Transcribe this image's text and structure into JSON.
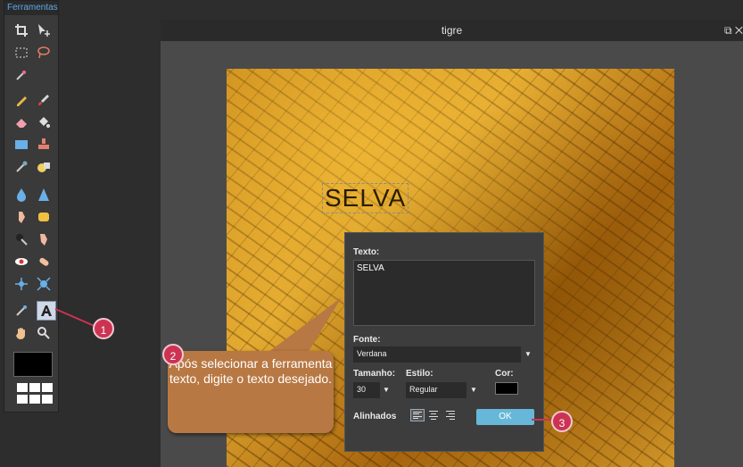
{
  "tools_panel": {
    "title": "Ferramentas"
  },
  "document": {
    "title": "tigre",
    "canvas_text": "SELVA",
    "window_controls": "⧉ ✕"
  },
  "dialog": {
    "text_label": "Texto:",
    "text_value": "SELVA",
    "font_label": "Fonte:",
    "font_value": "Verdana",
    "size_label": "Tamanho:",
    "size_value": "30",
    "style_label": "Estilo:",
    "style_value": "Regular",
    "color_label": "Cor:",
    "align_label": "Alinhados",
    "ok_label": "OK"
  },
  "callout": {
    "text": "Após selecionar a ferramenta texto, digite o texto desejado."
  },
  "badges": {
    "one": "1",
    "two": "2",
    "three": "3"
  },
  "colors": {
    "accent": "#67b8d8",
    "badge": "#cc3352",
    "callout": "#b87843",
    "text_color": "#000000"
  }
}
